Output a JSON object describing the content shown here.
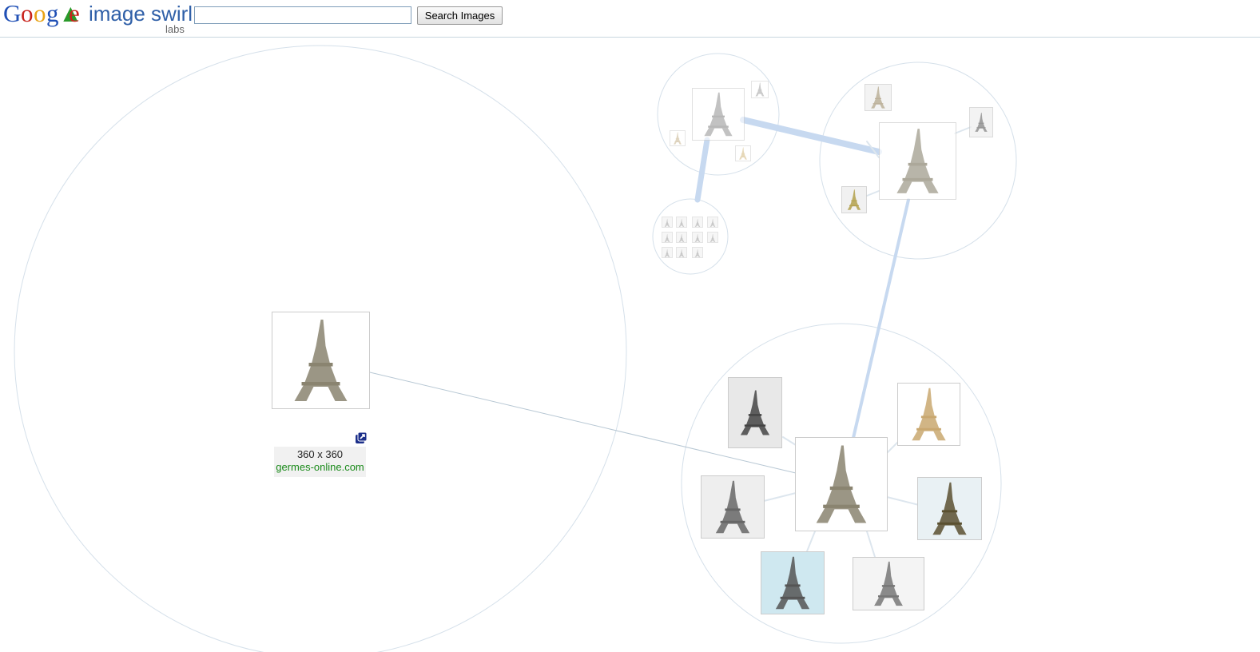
{
  "header": {
    "logo_text": "Google",
    "product_name": "image swirl",
    "product_tag": "labs",
    "search": {
      "value": "",
      "placeholder": ""
    },
    "search_button": "Search Images"
  },
  "selected_image": {
    "dimensions": "360 x 360",
    "source": "germes-online.com",
    "open_icon": "open-in-new-window-icon"
  },
  "colors": {
    "accent_link": "#1a8a1a",
    "cluster_edge": "#c7d9f0",
    "circle": "#d5e0ea"
  }
}
